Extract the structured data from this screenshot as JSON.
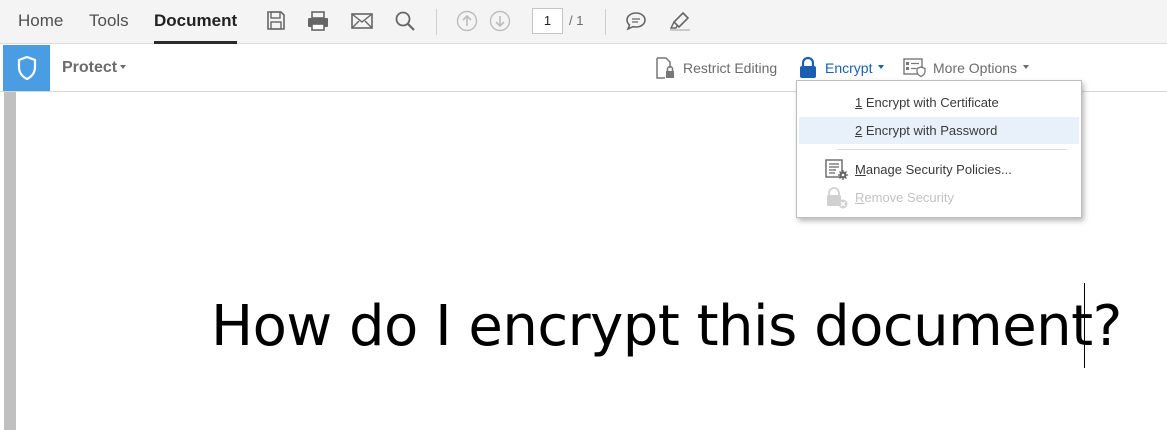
{
  "tabs": [
    {
      "label": "Home"
    },
    {
      "label": "Tools"
    },
    {
      "label": "Document",
      "active": true
    }
  ],
  "toolbar": {
    "icons": [
      "save-icon",
      "print-icon",
      "email-icon",
      "search-icon",
      "prev-page-icon",
      "next-page-icon",
      "comment-icon",
      "highlight-icon"
    ],
    "current_page": "1",
    "page_total": "/ 1"
  },
  "protect_bar": {
    "protect_label": "Protect",
    "restrict_editing": "Restrict Editing",
    "encrypt": "Encrypt",
    "more_options": "More Options"
  },
  "encrypt_menu": {
    "items": [
      {
        "accel": "1",
        "label": " Encrypt with Certificate",
        "highlighted": false,
        "enabled": true
      },
      {
        "accel": "2",
        "label": " Encrypt with Password",
        "highlighted": true,
        "enabled": true
      },
      {
        "accel": "M",
        "label": "anage Security Policies...",
        "icon": "security-policies-icon",
        "enabled": true
      },
      {
        "accel": "R",
        "label": "emove Security",
        "icon": "remove-security-icon",
        "enabled": false
      }
    ]
  },
  "document": {
    "text": "How do I encrypt this document?"
  },
  "colors": {
    "accent_blue": "#1a5fb4",
    "shield_tile": "#4a9de2",
    "menu_highlight": "#e8f1fa"
  }
}
